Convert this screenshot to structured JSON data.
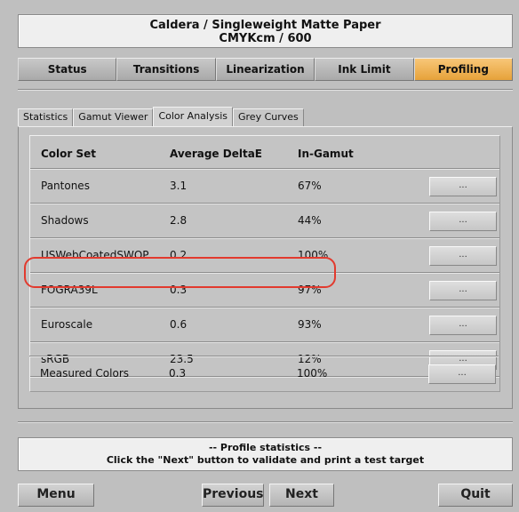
{
  "header": {
    "line1": "Caldera  / Singleweight Matte Paper",
    "line2": "CMYKcm / 600"
  },
  "main_tabs": [
    "Status",
    "Transitions",
    "Linearization",
    "Ink Limit",
    "Profiling"
  ],
  "active_main_tab": "Profiling",
  "sub_tabs": [
    "Statistics",
    "Gamut Viewer",
    "Color Analysis",
    "Grey Curves"
  ],
  "active_sub_tab": "Color Analysis",
  "table": {
    "columns": [
      "Color Set",
      "Average DeltaE",
      "In-Gamut"
    ],
    "rows": [
      {
        "name": "Pantones",
        "delta": "3.1",
        "gamut": "67%",
        "button": "..."
      },
      {
        "name": "Shadows",
        "delta": "2.8",
        "gamut": "44%",
        "button": "..."
      },
      {
        "name": "USWebCoatedSWOP",
        "delta": "0.2",
        "gamut": "100%",
        "button": "..."
      },
      {
        "name": "FOGRA39L",
        "delta": "0.3",
        "gamut": "97%",
        "button": "..."
      },
      {
        "name": "Euroscale",
        "delta": "0.6",
        "gamut": "93%",
        "button": "..."
      },
      {
        "name": "sRGB",
        "delta": "23.5",
        "gamut": "12%",
        "button": "..."
      },
      {
        "name": "Measured Colors",
        "delta": "0.3",
        "gamut": "100%",
        "button": "..."
      }
    ]
  },
  "highlighted_row": "FOGRA39L",
  "message": {
    "line1": "-- Profile statistics --",
    "line2": "Click the \"Next\" button to validate and print a test target"
  },
  "buttons": {
    "menu": "Menu",
    "previous": "Previous",
    "next": "Next",
    "quit": "Quit"
  },
  "colors": {
    "active_tab": "#e6a23a",
    "highlight": "#e23a2e",
    "background": "#bfbfbf"
  }
}
